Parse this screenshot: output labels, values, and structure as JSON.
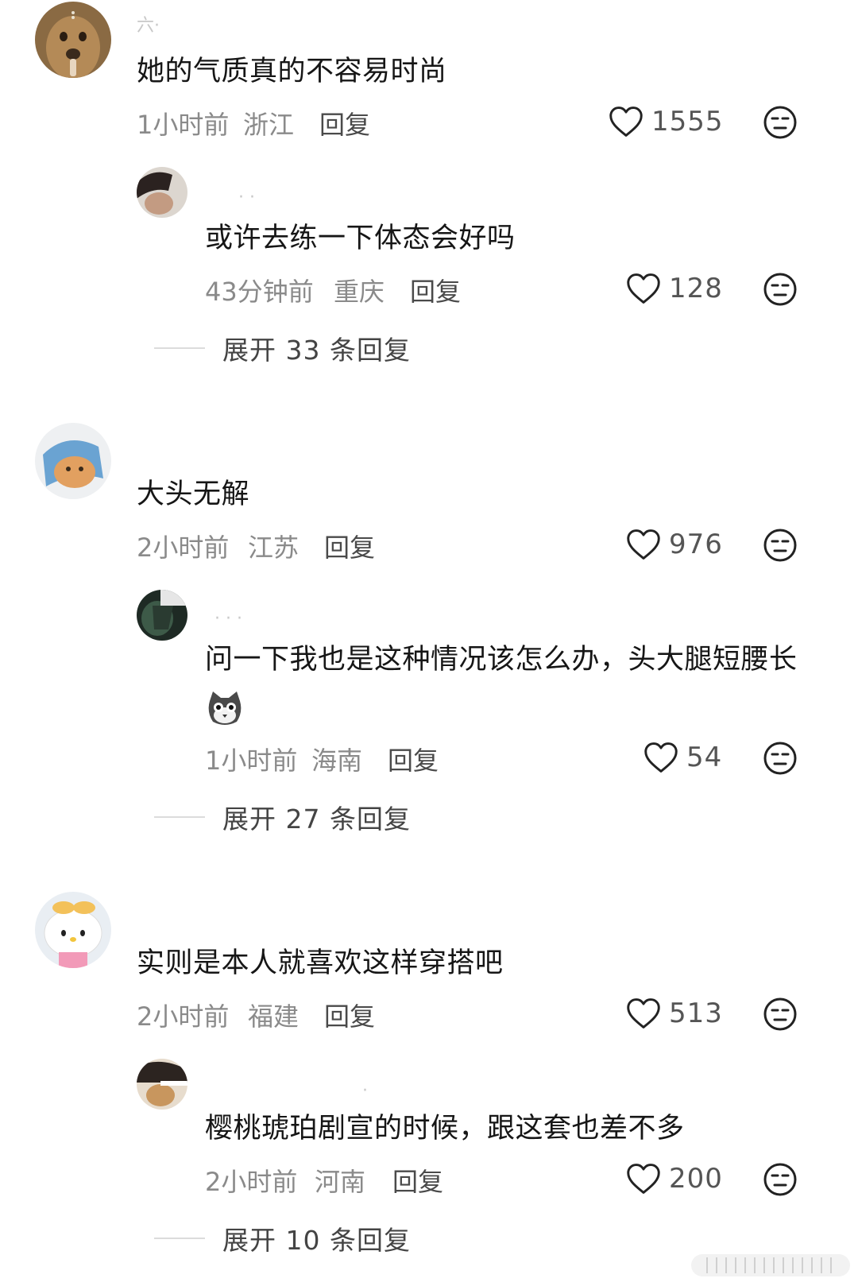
{
  "comments": [
    {
      "username": "六·",
      "text": "她的气质真的不容易时尚",
      "time": "1小时前",
      "location": "浙江",
      "reply_label": "回复",
      "likes": "1555",
      "replies": [
        {
          "username": "· ·",
          "text": "或许去练一下体态会好吗",
          "time": "43分钟前",
          "location": "重庆",
          "reply_label": "回复",
          "likes": "128"
        }
      ],
      "expand_label": "展开 33 条回复"
    },
    {
      "text": "大头无解",
      "time": "2小时前",
      "location": "江苏",
      "reply_label": "回复",
      "likes": "976",
      "replies": [
        {
          "username": "· · ·",
          "text": "问一下我也是这种情况该怎么办，头大腿短腰长",
          "time": "1小时前",
          "location": "海南",
          "reply_label": "回复",
          "likes": "54",
          "emoji": "cat-face-emoji"
        }
      ],
      "expand_label": "展开 27 条回复"
    },
    {
      "text": "实则是本人就喜欢这样穿搭吧",
      "time": "2小时前",
      "location": "福建",
      "reply_label": "回复",
      "likes": "513",
      "replies": [
        {
          "username": "·",
          "text": "樱桃琥珀剧宣的时候，跟这套也差不多",
          "time": "2小时前",
          "location": "河南",
          "reply_label": "回复",
          "likes": "200"
        }
      ],
      "expand_label": "展开 10 条回复"
    }
  ],
  "icons": {
    "like": "heart-outline-icon",
    "dislike": "meh-face-icon"
  },
  "colors": {
    "text": "#161616",
    "meta": "#8a8a8a",
    "divider": "#dcdcdc"
  }
}
